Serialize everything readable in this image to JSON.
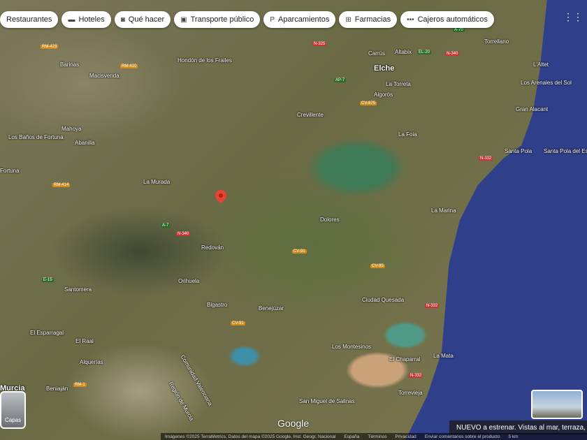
{
  "chips": [
    {
      "icon": "",
      "label": "Restaurantes"
    },
    {
      "icon": "bed-icon",
      "glyph": "▬",
      "label": "Hoteles"
    },
    {
      "icon": "camera-icon",
      "glyph": "◙",
      "label": "Qué hacer"
    },
    {
      "icon": "transit-icon",
      "glyph": "▣",
      "label": "Transporte público"
    },
    {
      "icon": "parking-icon",
      "glyph": "P",
      "label": "Aparcamientos"
    },
    {
      "icon": "pharmacy-icon",
      "glyph": "⊞",
      "label": "Farmacias"
    },
    {
      "icon": "atm-icon",
      "glyph": "•••",
      "label": "Cajeros automáticos"
    }
  ],
  "places": [
    {
      "n": "Elche",
      "big": true
    },
    {
      "n": "Crevillente"
    },
    {
      "n": "Torrellano"
    },
    {
      "n": "Altabix"
    },
    {
      "n": "Carrús"
    },
    {
      "n": "La Torreta"
    },
    {
      "n": "Algorós"
    },
    {
      "n": "La Foia"
    },
    {
      "n": "L'Altet"
    },
    {
      "n": "Los Arenales del Sol"
    },
    {
      "n": "Gran Alacant"
    },
    {
      "n": "Santa Pola"
    },
    {
      "n": "Santa Pola del Este"
    },
    {
      "n": "La Marina"
    },
    {
      "n": "Dolores"
    },
    {
      "n": "Redován"
    },
    {
      "n": "Orihuela"
    },
    {
      "n": "Bigastro"
    },
    {
      "n": "Benejúzar"
    },
    {
      "n": "Ciudad Quesada"
    },
    {
      "n": "Los Montesinos"
    },
    {
      "n": "El Chaparral"
    },
    {
      "n": "La Mata"
    },
    {
      "n": "Torrevieja"
    },
    {
      "n": "San Miguel de Salinas"
    },
    {
      "n": "Santomera"
    },
    {
      "n": "El Esparragal"
    },
    {
      "n": "El Raal"
    },
    {
      "n": "Alquerías"
    },
    {
      "n": "Beniaján"
    },
    {
      "n": "La Murada"
    },
    {
      "n": "Abanilla"
    },
    {
      "n": "Mahoya"
    },
    {
      "n": "Los Baños de Fortuna"
    },
    {
      "n": "Fortuna"
    },
    {
      "n": "Macisvenda"
    },
    {
      "n": "Barinas"
    },
    {
      "n": "Hondón de los Frailes"
    },
    {
      "n": "Comunidad Valenciana"
    },
    {
      "n": "Región de Murcia"
    },
    {
      "n": "Murcia",
      "big": true
    }
  ],
  "roads": [
    "N-325",
    "A-70",
    "N-340",
    "AP-7",
    "EL-20",
    "CV-875",
    "N-332",
    "A-7",
    "N-340",
    "CV-91",
    "CV-95",
    "CV-91",
    "N-332",
    "N-332",
    "RM-1",
    "RM-414",
    "RM-410",
    "RM-423",
    "E-15"
  ],
  "layers_label": "Capas",
  "google_logo": "Google",
  "attribution": "Imágenes ©2025 TerraMetrics, Datos del mapa ©2025 Google, Inst. Geogr. Nacional",
  "footer_links": [
    "España",
    "Términos",
    "Privacidad",
    "Enviar comentarios sobre el producto"
  ],
  "scale": "5 km",
  "notice": "NUEVO a estrenar. Vistas al mar, terraza,"
}
